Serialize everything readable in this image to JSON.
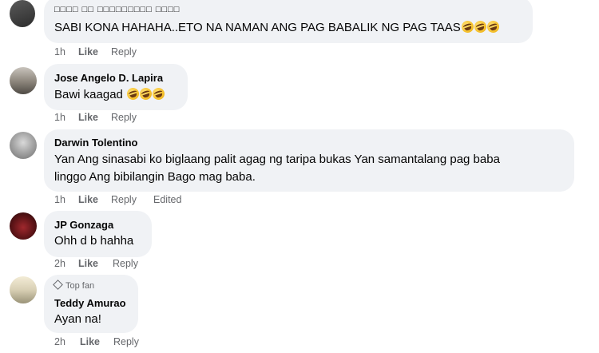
{
  "comments": [
    {
      "author": "□□□□ □□ □□□□□□□□□ □□□□",
      "text": "SABI KONA HAHAHA..ETO NA NAMAN ANG PAG BABALIK NG PAG TAAS",
      "emoji_count": 3,
      "time": "1h",
      "like": "Like",
      "reply": "Reply"
    },
    {
      "author": "Jose Angelo D. Lapira",
      "text": "Bawi kaagad",
      "emoji_count": 3,
      "time": "1h",
      "like": "Like",
      "reply": "Reply"
    },
    {
      "author": "Darwin Tolentino",
      "text_line1": "Yan Ang sinasabi ko biglaang palit agag ng taripa bukas Yan samantalang pag baba",
      "text_line2": "linggo Ang bibilangin Bago mag baba.",
      "time": "1h",
      "like": "Like",
      "reply": "Reply",
      "edited": "Edited"
    },
    {
      "author": "JP Gonzaga",
      "text": "Ohh d b hahha",
      "time": "2h",
      "like": "Like",
      "reply": "Reply"
    },
    {
      "badge": "Top fan",
      "author": "Teddy Amurao",
      "text": "Ayan na!",
      "time": "2h",
      "like": "Like",
      "reply": "Reply"
    }
  ],
  "colors": {
    "bubble": "#f0f2f5",
    "meta": "#65676b",
    "text": "#050505"
  },
  "icons": [
    "rolling-on-floor-laughing-emoji",
    "diamond-icon"
  ]
}
